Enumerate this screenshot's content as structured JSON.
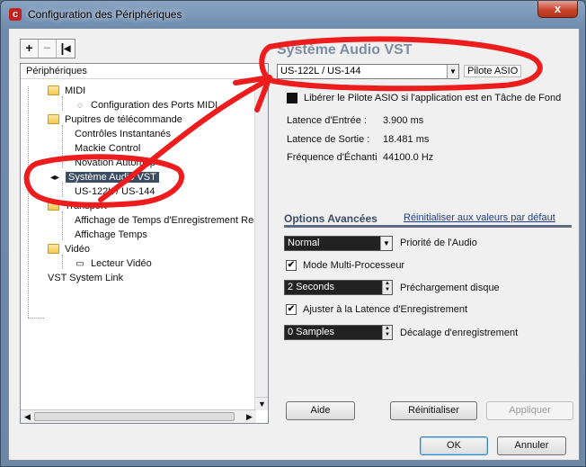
{
  "window": {
    "title": "Configuration des Périphériques",
    "close_glyph": "x",
    "app_icon": "cubase-logo-icon"
  },
  "toolbar": {
    "add": "+",
    "remove": "−",
    "reset": "|◂"
  },
  "tree": {
    "header": "Périphériques",
    "items": [
      {
        "label": "MIDI",
        "icon": "folder-icon"
      },
      {
        "label": "Configuration des Ports MIDI",
        "icon": "midi-port-icon"
      },
      {
        "label": "Pupitres de télécommande",
        "icon": "folder-icon"
      },
      {
        "label": "Contrôles Instantanés"
      },
      {
        "label": "Mackie Control"
      },
      {
        "label": "Novation Automap"
      },
      {
        "label": "Système Audio VST",
        "icon": "audio-system-icon",
        "selected": true
      },
      {
        "label": "US-122L / US-144"
      },
      {
        "label": "Transport",
        "icon": "folder-icon"
      },
      {
        "label": "Affichage de Temps d'Enregistrement Rest"
      },
      {
        "label": "Affichage Temps"
      },
      {
        "label": "Vidéo",
        "icon": "folder-icon"
      },
      {
        "label": "Lecteur Vidéo",
        "icon": "video-player-icon"
      },
      {
        "label": "VST System Link"
      }
    ]
  },
  "panel": {
    "title": "Système Audio VST",
    "driver": {
      "value": "US-122L / US-144",
      "button": "Pilote ASIO"
    },
    "release_driver": {
      "label": "Libérer le Pilote ASIO si l'application est en Tâche de Fond",
      "checked": false
    },
    "info": [
      {
        "label": "Latence d'Entrée :",
        "value": "3.900 ms"
      },
      {
        "label": "Latence de Sortie :",
        "value": "18.481 ms"
      },
      {
        "label": "Fréquence d'Échanti",
        "value": "44100.0 Hz"
      }
    ],
    "tabs": {
      "active": "Options Avancées",
      "reset_link": "Réinitialiser aux valeurs par défaut"
    },
    "priority": {
      "value": "Normal",
      "label": "Priorité de l'Audio"
    },
    "multiprocessor": {
      "label": "Mode Multi-Processeur",
      "checked": true
    },
    "preload": {
      "value": "2 Seconds",
      "label": "Préchargement disque"
    },
    "adjust_latency": {
      "label": "Ajuster à la Latence d'Enregistrement",
      "checked": true
    },
    "offset": {
      "value": "0 Samples",
      "label": "Décalage d'enregistrement"
    },
    "buttons": {
      "help": "Aide",
      "reset": "Réinitialiser",
      "apply": "Appliquer"
    }
  },
  "footer": {
    "ok": "OK",
    "cancel": "Annuler"
  },
  "colors": {
    "annotation": "#ee1c1c",
    "selection": "#3b4d63",
    "accent_text": "#7d8ea2"
  }
}
